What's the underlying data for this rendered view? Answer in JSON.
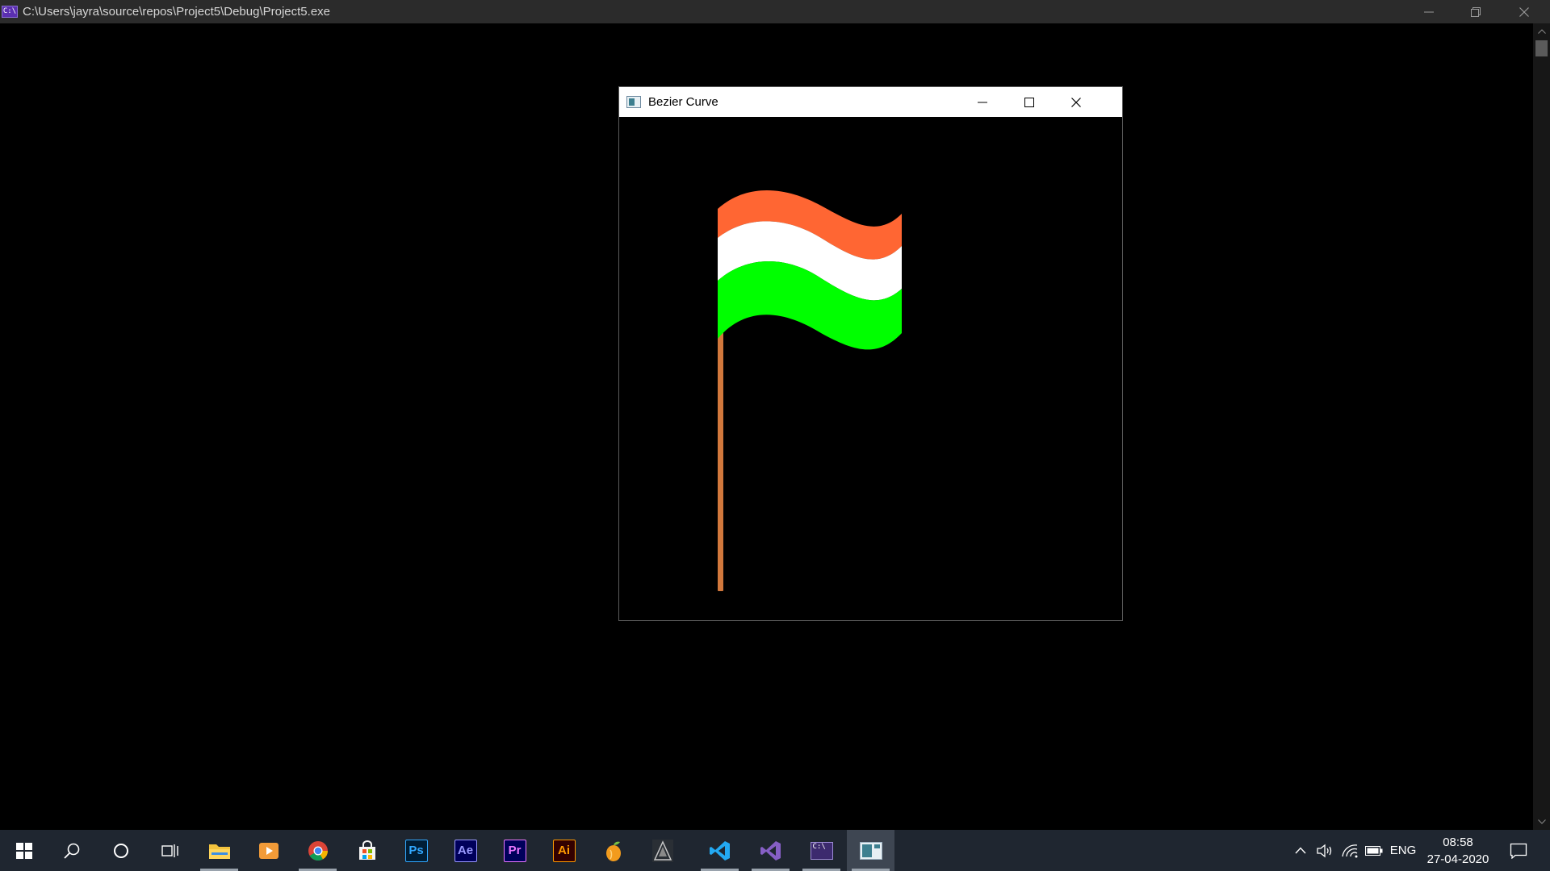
{
  "console": {
    "title": "C:\\Users\\jayra\\source\\repos\\Project5\\Debug\\Project5.exe",
    "icon_text": "C:\\",
    "icon": "console-app-icon"
  },
  "bezier": {
    "title": "Bezier Curve",
    "icon": "app-window-icon",
    "flag": {
      "top_color": "#ff6633",
      "middle_color": "#ffffff",
      "bottom_color": "#00ff00",
      "pole_color": "#d2783c"
    }
  },
  "taskbar": {
    "apps": [
      {
        "name": "file-explorer",
        "label": "",
        "running": true,
        "active": false
      },
      {
        "name": "media-player",
        "label": "",
        "running": false,
        "active": false
      },
      {
        "name": "chrome",
        "label": "",
        "running": true,
        "active": false
      },
      {
        "name": "microsoft-store",
        "label": "",
        "running": false,
        "active": false
      },
      {
        "name": "photoshop",
        "label": "Ps",
        "running": false,
        "active": false
      },
      {
        "name": "after-effects",
        "label": "Ae",
        "running": false,
        "active": false
      },
      {
        "name": "premiere-pro",
        "label": "Pr",
        "running": false,
        "active": false
      },
      {
        "name": "illustrator",
        "label": "Ai",
        "running": false,
        "active": false
      },
      {
        "name": "fl-studio",
        "label": "",
        "running": false,
        "active": false
      },
      {
        "name": "game-launcher",
        "label": "",
        "running": false,
        "active": false
      },
      {
        "name": "vs-code",
        "label": "",
        "running": true,
        "active": false
      },
      {
        "name": "visual-studio",
        "label": "",
        "running": true,
        "active": false
      },
      {
        "name": "console-app",
        "label": "C:\\",
        "running": true,
        "active": false
      },
      {
        "name": "bezier-app",
        "label": "",
        "running": true,
        "active": true
      }
    ],
    "tray": {
      "language": "ENG",
      "time": "08:58",
      "date": "27-04-2020"
    }
  }
}
